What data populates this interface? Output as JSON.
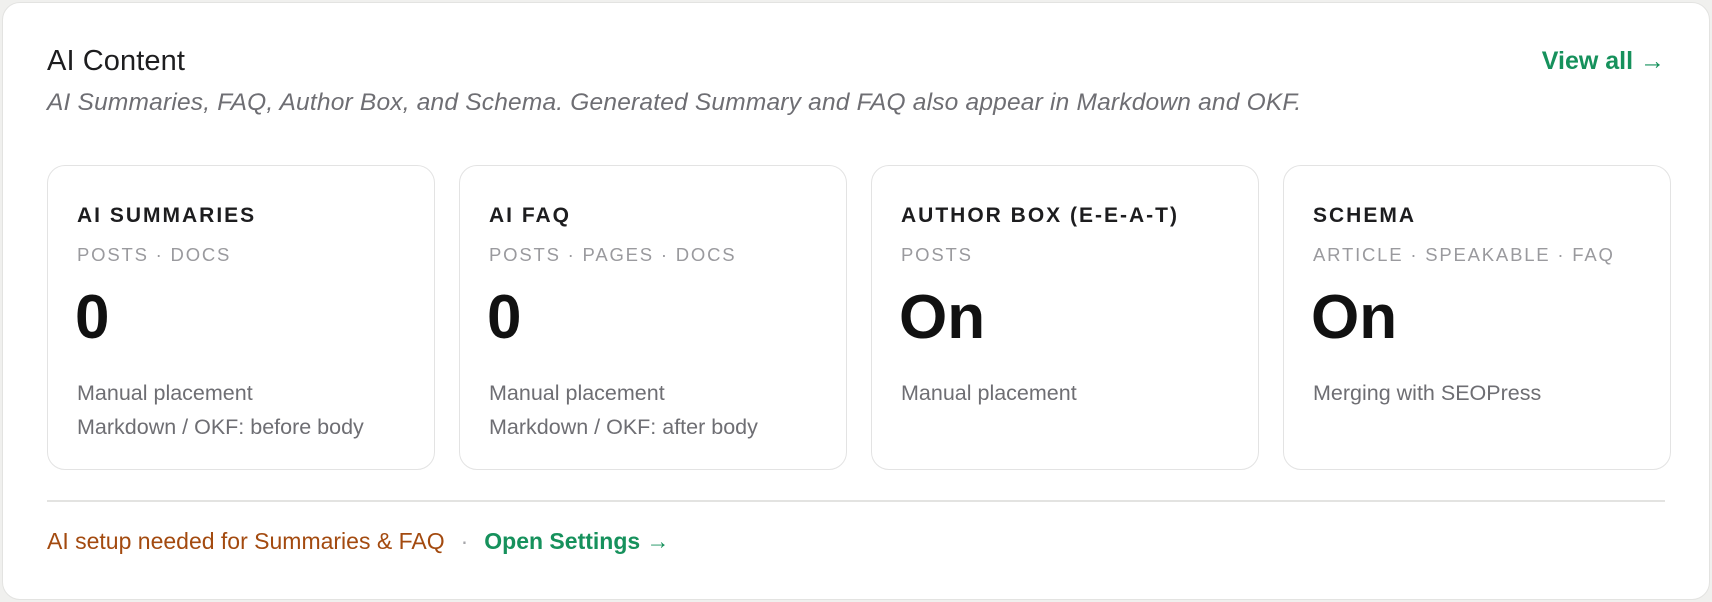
{
  "header": {
    "title": "AI Content",
    "view_all": "View all →",
    "subtitle": "AI Summaries, FAQ, Author Box, and Schema. Generated Summary and FAQ also appear in Markdown and OKF."
  },
  "cards": [
    {
      "title": "AI SUMMARIES",
      "scope": "POSTS · DOCS",
      "value": "0",
      "lines": [
        "Manual placement",
        "Markdown / OKF: before body"
      ]
    },
    {
      "title": "AI FAQ",
      "scope": "POSTS · PAGES · DOCS",
      "value": "0",
      "lines": [
        "Manual placement",
        "Markdown / OKF: after body"
      ]
    },
    {
      "title": "AUTHOR BOX (E-E-A-T)",
      "scope": "POSTS",
      "value": "On",
      "lines": [
        "Manual placement"
      ]
    },
    {
      "title": "SCHEMA",
      "scope": "ARTICLE · SPEAKABLE · FAQ",
      "value": "On",
      "lines": [
        "Merging with SEOPress"
      ]
    }
  ],
  "footer": {
    "warning": "AI setup needed for Summaries & FAQ",
    "separator": "·",
    "open_settings": "Open Settings →"
  },
  "colors": {
    "accent_green": "#16915c",
    "warning_orange": "#a34a0f"
  }
}
